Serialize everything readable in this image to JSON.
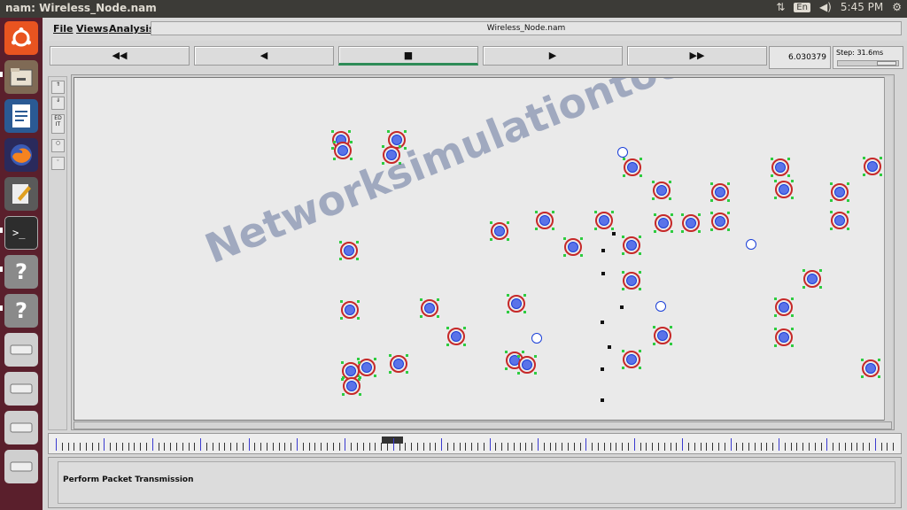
{
  "topbar": {
    "window_title": "nam: Wireless_Node.nam",
    "lang": "En",
    "time": "5:45 PM"
  },
  "menu": {
    "file": "File",
    "views": "Views",
    "analysis": "Analysis"
  },
  "file_name": "Wireless_Node.nam",
  "controls": {
    "rewind": "◀◀",
    "back": "◀",
    "stop": "■",
    "play": "▶",
    "fast_forward": "▶▶"
  },
  "time_value": "6.030379",
  "step_label": "Step: 31.6ms",
  "tools": {
    "edit": "ED IT"
  },
  "watermark": "Networksimulationtools.com",
  "status_text": "Perform Packet Transmission",
  "icons": {
    "launcher": [
      "ubuntu-logo-icon",
      "files-icon",
      "writer-icon",
      "firefox-icon",
      "text-editor-icon",
      "terminal-icon",
      "help-icon",
      "help-icon",
      "drive-icon",
      "drive-icon",
      "drive-icon",
      "drive-icon"
    ],
    "tray": [
      "network-arrows-icon",
      "volume-icon",
      "gear-icon"
    ]
  },
  "colors": {
    "node_ring": "#c62828",
    "node_fill": "#1a3fd8",
    "launcher_bg": "#5a1f2c"
  }
}
